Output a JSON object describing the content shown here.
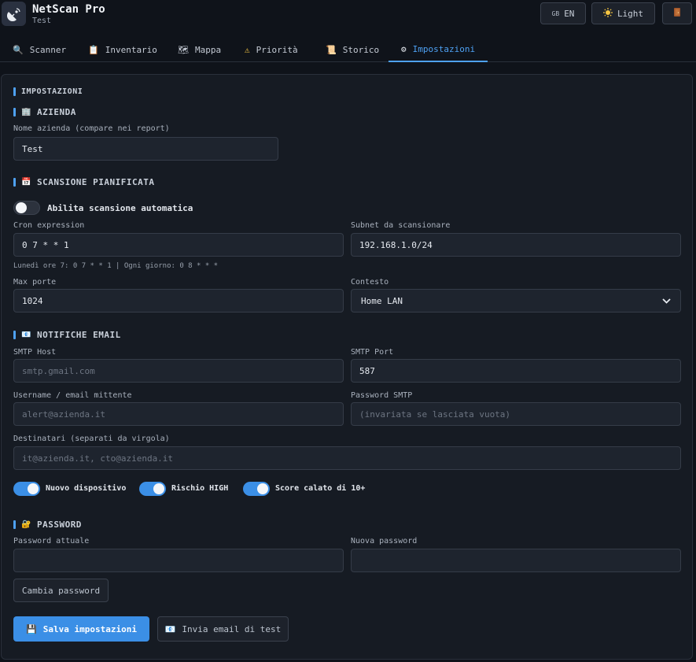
{
  "header": {
    "title": "NetScan Pro",
    "subtitle": "Test",
    "lang_flag": "GB",
    "lang_label": "EN",
    "theme_icon": "sun-icon",
    "theme_label": "Light",
    "logout_icon": "door-icon"
  },
  "tabs": [
    {
      "label": "Scanner",
      "icon": "🔍"
    },
    {
      "label": "Inventario",
      "icon": "📋"
    },
    {
      "label": "Mappa",
      "icon": "🗺"
    },
    {
      "label": "Priorità",
      "icon": "⚠"
    },
    {
      "label": "Storico",
      "icon": "📜"
    },
    {
      "label": "Impostazioni",
      "icon": "⚙",
      "active": true
    }
  ],
  "settings": {
    "heading": "IMPOSTAZIONI",
    "company": {
      "heading": "AZIENDA",
      "icon": "🏢",
      "name_label": "Nome azienda (compare nei report)",
      "name_value": "Test"
    },
    "schedule": {
      "heading": "SCANSIONE PIANIFICATA",
      "icon": "📅",
      "auto_label": "Abilita scansione automatica",
      "auto_enabled": false,
      "cron_label": "Cron expression",
      "cron_value": "0 7 * * 1",
      "subnet_label": "Subnet da scansionare",
      "subnet_value": "192.168.1.0/24",
      "cron_hint": "Lunedì ore 7: 0 7 * * 1 | Ogni giorno: 0 8 * * *",
      "maxports_label": "Max porte",
      "maxports_value": "1024",
      "context_label": "Contesto",
      "context_value": "Home LAN"
    },
    "email": {
      "heading": "NOTIFICHE EMAIL",
      "icon": "📧",
      "host_label": "SMTP Host",
      "host_placeholder": "smtp.gmail.com",
      "port_label": "SMTP Port",
      "port_value": "587",
      "user_label": "Username / email mittente",
      "user_placeholder": "alert@azienda.it",
      "pass_label": "Password SMTP",
      "pass_placeholder": "(invariata se lasciata vuota)",
      "recipients_label": "Destinatari (separati da virgola)",
      "recipients_placeholder": "it@azienda.it, cto@azienda.it",
      "toggle_new_device": "Nuovo dispositivo",
      "toggle_high_risk": "Rischio HIGH",
      "toggle_score_drop": "Score calato di 10+"
    },
    "password": {
      "heading": "PASSWORD",
      "icon": "🔐",
      "current_label": "Password attuale",
      "new_label": "Nuova password",
      "change_button": "Cambia password"
    },
    "actions": {
      "save_icon": "💾",
      "save_label": "Salva impostazioni",
      "test_icon": "📧",
      "test_label": "Invia email di test"
    }
  },
  "colors": {
    "accent": "#3b8fe6",
    "background": "#0f131a",
    "panel": "#161b23"
  }
}
